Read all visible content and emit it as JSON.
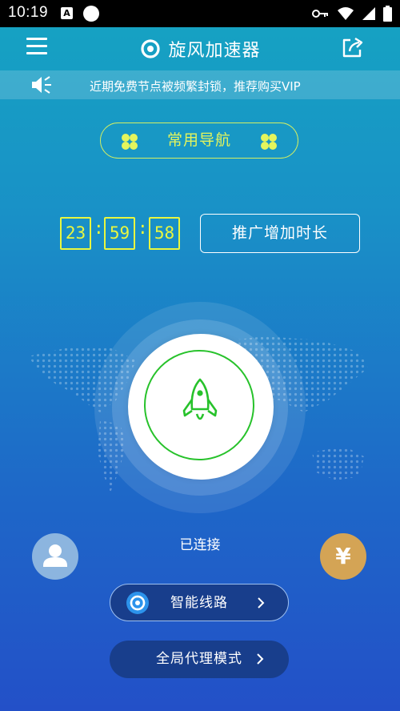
{
  "status_bar": {
    "time": "10:19",
    "notif_letter": "A"
  },
  "header": {
    "title": "旋风加速器"
  },
  "notice": {
    "text": "近期免费节点被频繁封锁，推荐购买VIP"
  },
  "nav": {
    "label": "常用导航"
  },
  "timer": {
    "hours": "23",
    "minutes": "59",
    "seconds": "58",
    "separator": ":"
  },
  "promo": {
    "label": "推广增加时长"
  },
  "connection": {
    "status": "已连接"
  },
  "vip_button": {
    "symbol": "¥"
  },
  "route_button": {
    "label": "智能线路"
  },
  "mode_button": {
    "label": "全局代理模式"
  },
  "colors": {
    "accent_yellow": "#e9f73f",
    "connect_green": "#27c22b",
    "vip_gold": "#d4a455"
  },
  "icons": [
    "menu-icon",
    "logo-icon",
    "share-icon",
    "speaker-icon",
    "clover-icon",
    "rocket-icon",
    "user-icon",
    "route-icon",
    "chevron-right-icon",
    "key-icon",
    "wifi-icon",
    "signal-icon",
    "battery-icon"
  ]
}
